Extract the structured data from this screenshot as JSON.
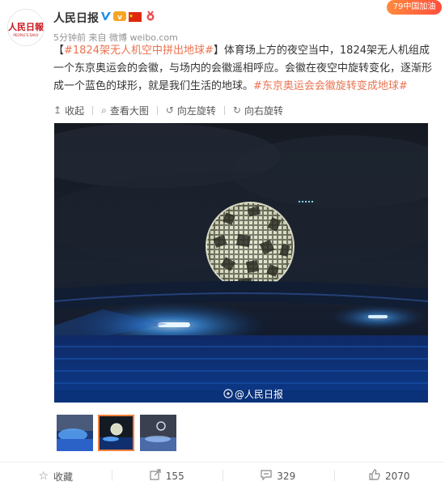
{
  "post": {
    "author": "人民日报",
    "meta_time": "5分钟前",
    "meta_from": "来自",
    "meta_source": "微博 weibo.com",
    "follow_label": "79中国加油",
    "content_open_bracket": "【",
    "content_topic": "#1824架无人机空中拼出地球#",
    "content_close_bracket": "】",
    "content_body": "体育场上方的夜空当中，1824架无人机组成一个东京奥运会的会徽，与场内的会徽遥相呼应。会徽在夜空中旋转变化，逐渐形成一个蓝色的球形，就是我们生活的地球。",
    "content_tag": "#东京奥运会会徽旋转变成地球#"
  },
  "toolbar": {
    "collapse": "收起",
    "view_large": "查看大图",
    "rotate_left": "向左旋转",
    "rotate_right": "向右旋转"
  },
  "image": {
    "watermark": "@人民日报"
  },
  "footer": {
    "favorite": "收藏",
    "repost_count": "155",
    "comment_count": "329",
    "like_count": "2070"
  },
  "colors": {
    "link": "#eb7350",
    "accent": "#f07f3a"
  }
}
